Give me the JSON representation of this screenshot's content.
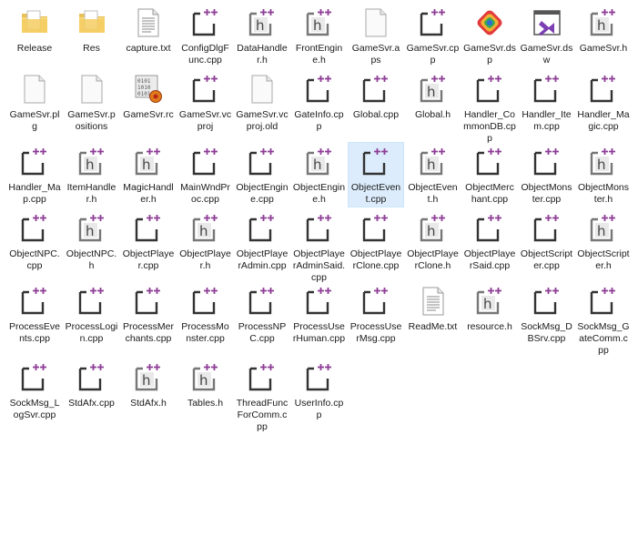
{
  "files": [
    {
      "name": "Release",
      "icon": "folder-icon"
    },
    {
      "name": "Res",
      "icon": "folder-icon"
    },
    {
      "name": "capture.txt",
      "icon": "text-file-icon"
    },
    {
      "name": "ConfigDlgFunc.cpp",
      "icon": "cpp-file-icon"
    },
    {
      "name": "DataHandler.h",
      "icon": "header-file-icon"
    },
    {
      "name": "FrontEngine.h",
      "icon": "header-file-icon"
    },
    {
      "name": "GameSvr.aps",
      "icon": "blank-file-icon"
    },
    {
      "name": "GameSvr.cpp",
      "icon": "cpp-file-icon"
    },
    {
      "name": "GameSvr.dsp",
      "icon": "dsp-file-icon"
    },
    {
      "name": "GameSvr.dsw",
      "icon": "dsw-file-icon"
    },
    {
      "name": "GameSvr.h",
      "icon": "header-file-icon"
    },
    {
      "name": "GameSvr.plg",
      "icon": "blank-file-icon"
    },
    {
      "name": "GameSvr.positions",
      "icon": "blank-file-icon"
    },
    {
      "name": "GameSvr.rc",
      "icon": "rc-file-icon"
    },
    {
      "name": "GameSvr.vcproj",
      "icon": "cpp-file-icon"
    },
    {
      "name": "GameSvr.vcproj.old",
      "icon": "blank-file-icon"
    },
    {
      "name": "GateInfo.cpp",
      "icon": "cpp-file-icon"
    },
    {
      "name": "Global.cpp",
      "icon": "cpp-file-icon"
    },
    {
      "name": "Global.h",
      "icon": "header-file-icon"
    },
    {
      "name": "Handler_CommonDB.cpp",
      "icon": "cpp-file-icon"
    },
    {
      "name": "Handler_Item.cpp",
      "icon": "cpp-file-icon"
    },
    {
      "name": "Handler_Magic.cpp",
      "icon": "cpp-file-icon"
    },
    {
      "name": "Handler_Map.cpp",
      "icon": "cpp-file-icon"
    },
    {
      "name": "ItemHandler.h",
      "icon": "header-file-icon"
    },
    {
      "name": "MagicHandler.h",
      "icon": "header-file-icon"
    },
    {
      "name": "MainWndProc.cpp",
      "icon": "cpp-file-icon"
    },
    {
      "name": "ObjectEngine.cpp",
      "icon": "cpp-file-icon"
    },
    {
      "name": "ObjectEngine.h",
      "icon": "header-file-icon"
    },
    {
      "name": "ObjectEvent.cpp",
      "icon": "cpp-file-icon",
      "selected": true
    },
    {
      "name": "ObjectEvent.h",
      "icon": "header-file-icon"
    },
    {
      "name": "ObjectMerchant.cpp",
      "icon": "cpp-file-icon"
    },
    {
      "name": "ObjectMonster.cpp",
      "icon": "cpp-file-icon"
    },
    {
      "name": "ObjectMonster.h",
      "icon": "header-file-icon"
    },
    {
      "name": "ObjectNPC.cpp",
      "icon": "cpp-file-icon"
    },
    {
      "name": "ObjectNPC.h",
      "icon": "header-file-icon"
    },
    {
      "name": "ObjectPlayer.cpp",
      "icon": "cpp-file-icon"
    },
    {
      "name": "ObjectPlayer.h",
      "icon": "header-file-icon"
    },
    {
      "name": "ObjectPlayerAdmin.cpp",
      "icon": "cpp-file-icon"
    },
    {
      "name": "ObjectPlayerAdminSaid.cpp",
      "icon": "cpp-file-icon"
    },
    {
      "name": "ObjectPlayerClone.cpp",
      "icon": "cpp-file-icon"
    },
    {
      "name": "ObjectPlayerClone.h",
      "icon": "header-file-icon"
    },
    {
      "name": "ObjectPlayerSaid.cpp",
      "icon": "cpp-file-icon"
    },
    {
      "name": "ObjectScripter.cpp",
      "icon": "cpp-file-icon"
    },
    {
      "name": "ObjectScripter.h",
      "icon": "header-file-icon"
    },
    {
      "name": "ProcessEvents.cpp",
      "icon": "cpp-file-icon"
    },
    {
      "name": "ProcessLogin.cpp",
      "icon": "cpp-file-icon"
    },
    {
      "name": "ProcessMerchants.cpp",
      "icon": "cpp-file-icon"
    },
    {
      "name": "ProcessMonster.cpp",
      "icon": "cpp-file-icon"
    },
    {
      "name": "ProcessNPC.cpp",
      "icon": "cpp-file-icon"
    },
    {
      "name": "ProcessUserHuman.cpp",
      "icon": "cpp-file-icon"
    },
    {
      "name": "ProcessUserMsg.cpp",
      "icon": "cpp-file-icon"
    },
    {
      "name": "ReadMe.txt",
      "icon": "text-file-icon"
    },
    {
      "name": "resource.h",
      "icon": "header-file-icon"
    },
    {
      "name": "SockMsg_DBSrv.cpp",
      "icon": "cpp-file-icon"
    },
    {
      "name": "SockMsg_GateComm.cpp",
      "icon": "cpp-file-icon"
    },
    {
      "name": "SockMsg_LogSvr.cpp",
      "icon": "cpp-file-icon"
    },
    {
      "name": "StdAfx.cpp",
      "icon": "cpp-file-icon"
    },
    {
      "name": "StdAfx.h",
      "icon": "header-file-icon"
    },
    {
      "name": "Tables.h",
      "icon": "header-file-icon"
    },
    {
      "name": "ThreadFuncForComm.cpp",
      "icon": "cpp-file-icon"
    },
    {
      "name": "UserInfo.cpp",
      "icon": "cpp-file-icon"
    }
  ],
  "colors": {
    "accent_purple": "#8e3d96",
    "selection": "#dcecfc"
  }
}
